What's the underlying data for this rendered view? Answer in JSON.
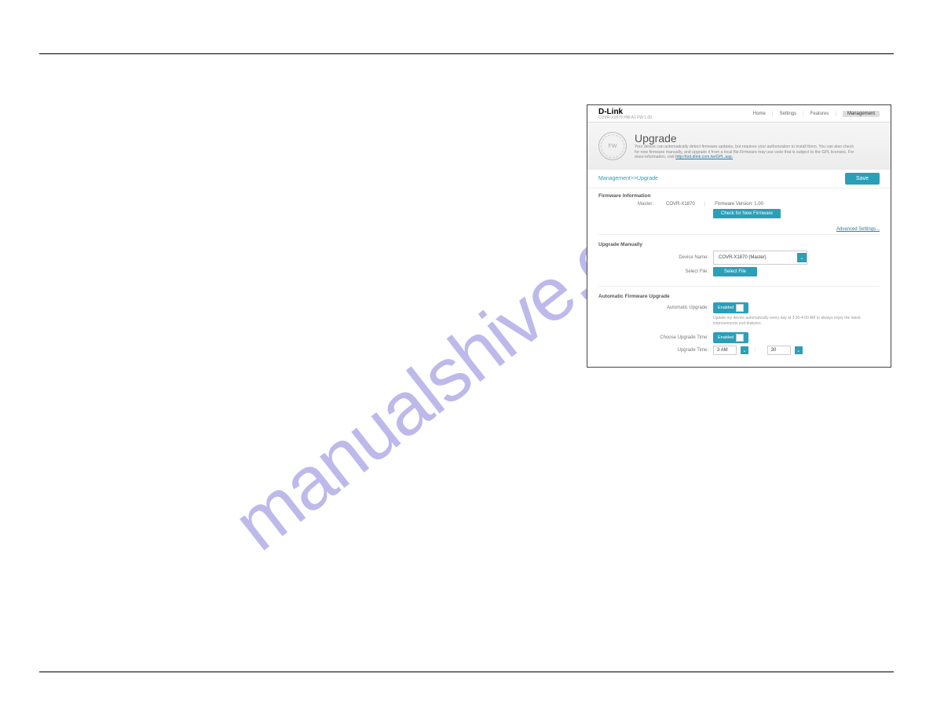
{
  "watermark": "manualshive.com",
  "ui": {
    "brand": "D-Link",
    "brand_sub": "COVR-X1870 HW:A1 FW:1.00",
    "nav": {
      "home": "Home",
      "settings": "Settings",
      "features": "Features",
      "management": "Management"
    },
    "hero": {
      "icon_text": "FW",
      "title": "Upgrade",
      "desc_1": "Your device can automatically detect firmware updates, but requires your authorization to install them. You can also check for new firmware manually, and upgrade it from a local file.Firmware may use code that is subject to the GPL licenses. For more information, visit ",
      "link": "http://tsd.dlink.com.tw/GPL.asp."
    },
    "crumb": "Management>>Upgrade",
    "save": "Save",
    "fw_info": {
      "title": "Firmware Information",
      "master": "Master:",
      "model": "COVR-X1870",
      "sep": "|",
      "ver_label": "Firmware Version: 1.00",
      "check_btn": "Check for New Firmware",
      "adv": "Advanced Settings..."
    },
    "manual": {
      "title": "Upgrade Manually",
      "device_label": "Device Name:",
      "device_value": "COVR-X1870 (Master)",
      "file_label": "Select File:",
      "file_btn": "Select File"
    },
    "auto": {
      "title": "Automatic Firmware Upgrade",
      "auto_label": "Automatic Upgrade:",
      "enabled": "Enabled",
      "note": "Update my device automatically every day at 3:30-4:00 AM to always enjoy the latest improvements and features.",
      "choose_label": "Choose Upgrade Time:",
      "time_label": "Upgrade Time:",
      "hour": "3 AM",
      "colon": ":",
      "minute": "30"
    }
  }
}
